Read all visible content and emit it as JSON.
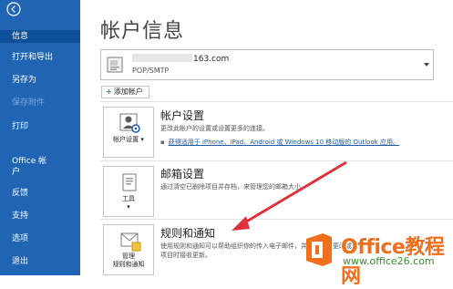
{
  "sidebar": {
    "items": [
      {
        "label": "信息",
        "active": true
      },
      {
        "label": "打开和导出"
      },
      {
        "label": "另存为"
      },
      {
        "label": "保存附件",
        "disabled": true
      },
      {
        "label": "打印"
      },
      {
        "label": "Office 帐户"
      },
      {
        "label": "反馈"
      },
      {
        "label": "支持"
      },
      {
        "label": "选项"
      },
      {
        "label": "退出"
      }
    ]
  },
  "main": {
    "title": "帐户信息",
    "account": {
      "email": "163.com",
      "type": "POP/SMTP"
    },
    "add_account_label": "添加帐户",
    "sections": [
      {
        "tile_label": "帐户设置",
        "title": "帐户设置",
        "description": "更改此帐户的设置或设置更多的连接。",
        "link": "获得适用于 iPhone、iPad、Android 或 Windows 10 移动版的 Outlook 应用。"
      },
      {
        "tile_label": "工具",
        "title": "邮箱设置",
        "description": "通过清空已删除项目并存档，来管理您的邮箱大小。"
      },
      {
        "tile_label": "管理\n规则和通知",
        "title": "规则和通知",
        "description": "使用规则和通知可以帮助组织你的传入电子邮件，并在添加、更改或删除项目时接收更新。"
      }
    ]
  },
  "watermark": {
    "title": "Office教程网",
    "url": "www.office26.com"
  },
  "colors": {
    "sidebar_bg": "#1f65b4",
    "sidebar_active": "#0f4f97",
    "arrow": "#e0313b",
    "watermark_orange": "#ef6f1d",
    "watermark_green": "#3a8f2f"
  }
}
